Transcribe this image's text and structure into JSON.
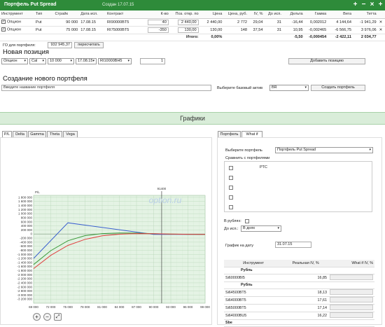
{
  "portfolio": {
    "title": "Портфель Put Spread",
    "created": "Создан 17.07.15",
    "controls": [
      "+",
      "−",
      "×",
      "+"
    ]
  },
  "positions_table": {
    "columns": [
      "Инструмент",
      "Тип",
      "Страйк",
      "Дата исп.",
      "Контракт",
      "К-во",
      "Поз. откр. по",
      "Цена",
      "Цена, руб.",
      "IV, %",
      "До исп.",
      "Дельта",
      "Гамма",
      "Вега",
      "Тетта"
    ],
    "rows": [
      {
        "checked": true,
        "instrument": "Опцион",
        "type": "Put",
        "strike": "90 000",
        "date": "17.08.15",
        "contract": "RI90000BT5",
        "qty": "40",
        "open_price": "2 440,00",
        "price": "2 440,00",
        "price_rub": "2 772",
        "iv": "29,04",
        "days": "31",
        "delta": "-16,44",
        "gamma": "0,002012",
        "vega": "4 144,64",
        "theta": "-1 941,29"
      },
      {
        "checked": true,
        "instrument": "Опцион",
        "type": "Put",
        "strike": "75 000",
        "date": "17.08.15",
        "contract": "RI75000BT5",
        "qty": "-350",
        "open_price": "130,00",
        "price": "130,00",
        "price_rub": "148",
        "iv": "37,54",
        "days": "31",
        "delta": "10,95",
        "gamma": "-0,002465",
        "vega": "-6 566,75",
        "theta": "3 976,06"
      }
    ],
    "total": {
      "label": "Итого:",
      "pct": "0,00%",
      "delta": "-5,50",
      "gamma": "-0,000454",
      "vega": "-2 422,11",
      "theta": "2 034,77"
    }
  },
  "go": {
    "label": "ГО для портфеля:",
    "value": "932 945,37",
    "recalc": "пересчитать"
  },
  "new_position": {
    "heading": "Новая позиция",
    "instrument": "Опцион",
    "type": "Cal",
    "strike": "10 000",
    "date": "17.08.15",
    "contract": "RI10000BH5",
    "qty": "1",
    "add_button": "Добавить позицию"
  },
  "new_portfolio": {
    "heading": "Создание нового портфеля",
    "name_placeholder": "Введите название портфеля",
    "asset_label": "Выберите базовый актив",
    "asset_value": "BR",
    "create_button": "Создать портфель"
  },
  "charts_header": "Графики",
  "chart_tabs": [
    "P/L",
    "Delta",
    "Gamma",
    "Theta",
    "Vega"
  ],
  "chart_data": {
    "type": "line",
    "title": "",
    "xlabel": "",
    "ylabel": "P/L",
    "watermark": "option.ru",
    "marker_label": "91400",
    "marker_x": 91400,
    "xlim": [
      69000,
      99000
    ],
    "ylim": [
      -3400000,
      1900000
    ],
    "x_ticks": [
      "69 000",
      "72 000",
      "75 000",
      "78 000",
      "81 000",
      "84 000",
      "87 000",
      "90 000",
      "93 000",
      "96 000",
      "99 000"
    ],
    "y_ticks": [
      "1 800 000",
      "1 600 000",
      "1 400 000",
      "1 200 000",
      "1 000 000",
      "800 000",
      "600 000",
      "400 000",
      "200 000",
      "0",
      "-200 000",
      "-400 000",
      "-600 000",
      "-800 000",
      "-1 000 000",
      "-1 200 000",
      "-1 400 000",
      "-1 600 000",
      "-1 800 000",
      "-2 000 000",
      "-2 200 000",
      "-2 400 000",
      "-2 600 000",
      "-2 800 000",
      "-3 000 000",
      "-3 200 000"
    ],
    "series": [
      {
        "color": "#3a5fcf",
        "x": [
          69000,
          75000,
          90000,
          99000
        ],
        "y": [
          -1200000,
          550000,
          -20000,
          -20000
        ]
      },
      {
        "color": "#3a9a3a",
        "x": [
          69000,
          72000,
          75000,
          78000,
          81000,
          84000,
          87000,
          90000,
          93000,
          96000,
          99000
        ],
        "y": [
          -1500000,
          -820000,
          -330000,
          -80000,
          20000,
          50000,
          45000,
          15000,
          -5000,
          -15000,
          -20000
        ]
      },
      {
        "color": "#e04040",
        "x": [
          69000,
          72000,
          75000,
          78000,
          81000,
          84000,
          87000,
          90000,
          93000,
          96000,
          99000
        ],
        "y": [
          -1700000,
          -1050000,
          -560000,
          -260000,
          -90000,
          -10000,
          20000,
          15000,
          0,
          -12000,
          -18000
        ]
      }
    ]
  },
  "zoom_buttons": [
    "zoom-in-icon",
    "zoom-out-icon",
    "zoom-reset-icon"
  ],
  "whatif": {
    "tabs": [
      "Портфель",
      "What if"
    ],
    "select_portfolio_label": "Выберите портфель",
    "select_portfolio_value": "Портфель Put Spread",
    "compare_label": "Сравнить с портфелями",
    "compare_items": [
      "РТС",
      "",
      "",
      "",
      ""
    ],
    "rub_label": "В рублях:",
    "expiry_label": "До исп.:",
    "expiry_value": "В днях",
    "date_label": "График на дату",
    "date_value": "31.07.15",
    "iv_table": {
      "columns": [
        "Инструмент",
        "Реальная IV, %",
        "What if IV, %"
      ],
      "groups": [
        {
          "label": "Рубль",
          "rows": [
            {
              "name": "Si60000BI5",
              "iv": "16,85"
            }
          ]
        },
        {
          "label": "Рубль",
          "rows": [
            {
              "name": "Si64500BT5",
              "iv": "18,13"
            },
            {
              "name": "Si64000BT5",
              "iv": "17,61"
            },
            {
              "name": "Si65000BT5",
              "iv": "17,14"
            },
            {
              "name": "Si64000BU5",
              "iv": "16,22"
            }
          ]
        }
      ],
      "footer": "Sbe"
    }
  }
}
